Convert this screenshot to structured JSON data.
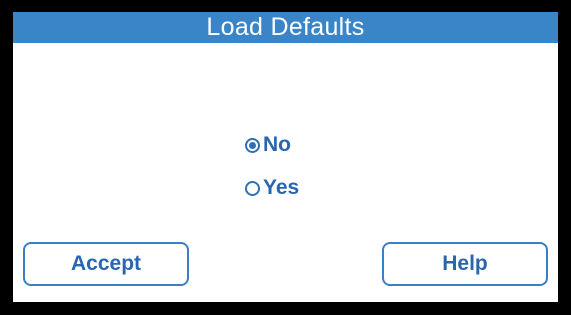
{
  "window": {
    "title": "Load Defaults"
  },
  "options": [
    {
      "label": "No",
      "selected": true
    },
    {
      "label": "Yes",
      "selected": false
    }
  ],
  "buttons": {
    "accept_label": "Accept",
    "help_label": "Help"
  },
  "colors": {
    "title_bar": "#3a84c8",
    "accent": "#2a66b0",
    "background": "#ffffff",
    "bezel": "#000000"
  }
}
